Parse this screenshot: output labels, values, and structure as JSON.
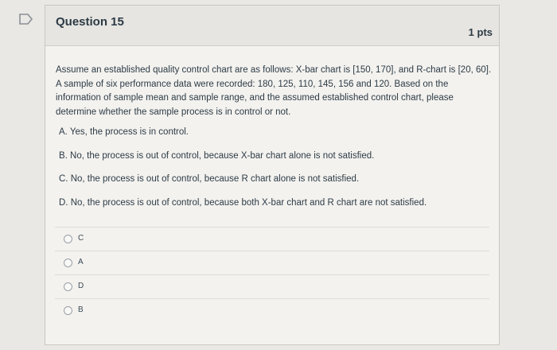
{
  "question": {
    "title": "Question 15",
    "points": "1 pts",
    "paragraph": "Assume an established quality control chart are as follows: X-bar chart is [150, 170], and R-chart is [20, 60]. A sample of six performance data were recorded: 180, 125, 110, 145, 156 and 120. Based on the information of sample mean and sample range, and the assumed established control chart, please determine whether the sample process is in control or not.",
    "options": [
      "A. Yes, the process is in control.",
      "B. No, the process is out of control, because X-bar chart alone is not satisfied.",
      "C. No, the process is out of control, because R chart alone is not satisfied.",
      "D. No, the process is out of control, because both X-bar chart and R chart are not satisfied."
    ]
  },
  "answers": [
    "C",
    "A",
    "D",
    "B"
  ],
  "colors": {
    "background": "#e9e8e4",
    "card": "#f3f2ef",
    "header": "#e6e5e1",
    "text": "#2d3b45"
  },
  "icons": {
    "flag": "question-flag-icon"
  }
}
